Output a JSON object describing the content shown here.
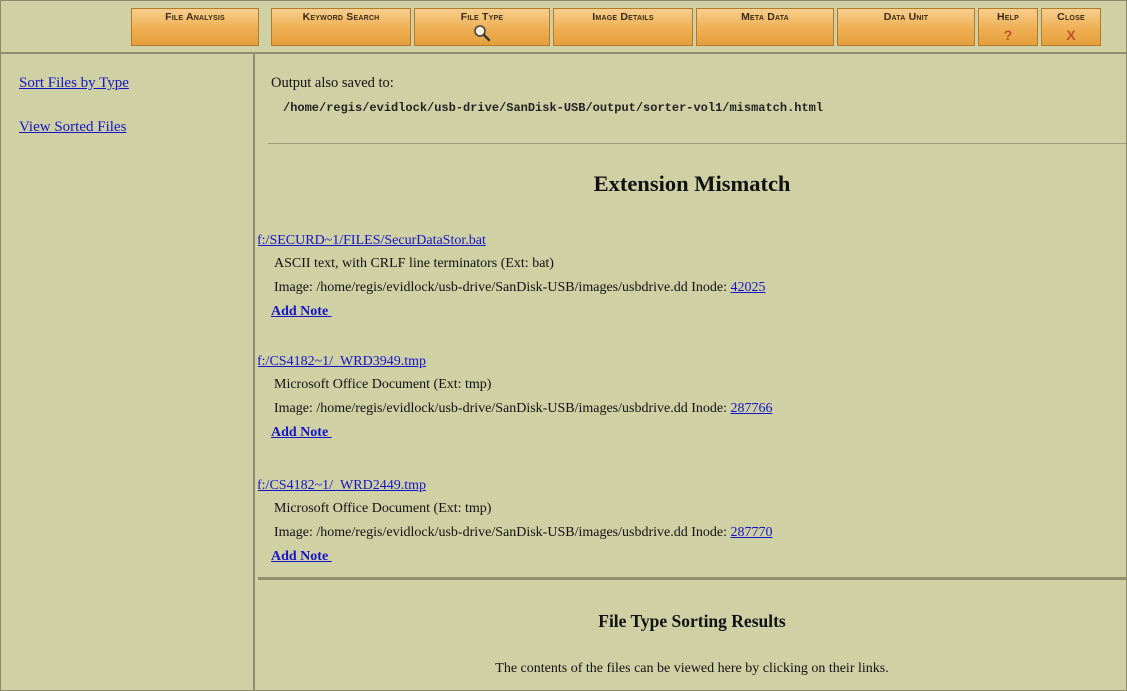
{
  "toolbar": {
    "file_analysis": "File Analysis",
    "keyword_search": "Keyword Search",
    "file_type": "File Type",
    "image_details": "Image Details",
    "meta_data": "Meta Data",
    "data_unit": "Data Unit",
    "help": "Help",
    "help_mark": "?",
    "close": "Close",
    "close_mark": "X",
    "search_icon": "magnifier-icon"
  },
  "sidebar": {
    "sort_files": "Sort Files by Type",
    "view_sorted": "View Sorted Files"
  },
  "output": {
    "label": "Output also saved to:",
    "path": "/home/regis/evidlock/usb-drive/SanDisk-USB/output/sorter-vol1/mismatch.html"
  },
  "mismatch": {
    "heading": "Extension Mismatch",
    "image_prefix": "Image: /home/regis/evidlock/usb-drive/SanDisk-USB/images/usbdrive.dd Inode: ",
    "entries": [
      {
        "file": "f:/SECURD~1/FILES/SecurDataStor.bat",
        "desc": "ASCII text, with CRLF line terminators (Ext: bat)",
        "inode": "42025",
        "note": "Add Note "
      },
      {
        "file": "f:/CS4182~1/_WRD3949.tmp",
        "desc": "Microsoft Office Document (Ext: tmp)",
        "inode": "287766",
        "note": "Add Note "
      },
      {
        "file": "f:/CS4182~1/_WRD2449.tmp",
        "desc": "Microsoft Office Document (Ext: tmp)",
        "inode": "287770",
        "note": "Add Note "
      }
    ]
  },
  "sorting": {
    "heading": "File Type Sorting Results",
    "note": "The contents of the files can be viewed here by clicking on their links."
  },
  "colors": {
    "background": "#cfd0a4",
    "toolbar_button": "#eeaf52",
    "link": "#1515c6"
  }
}
